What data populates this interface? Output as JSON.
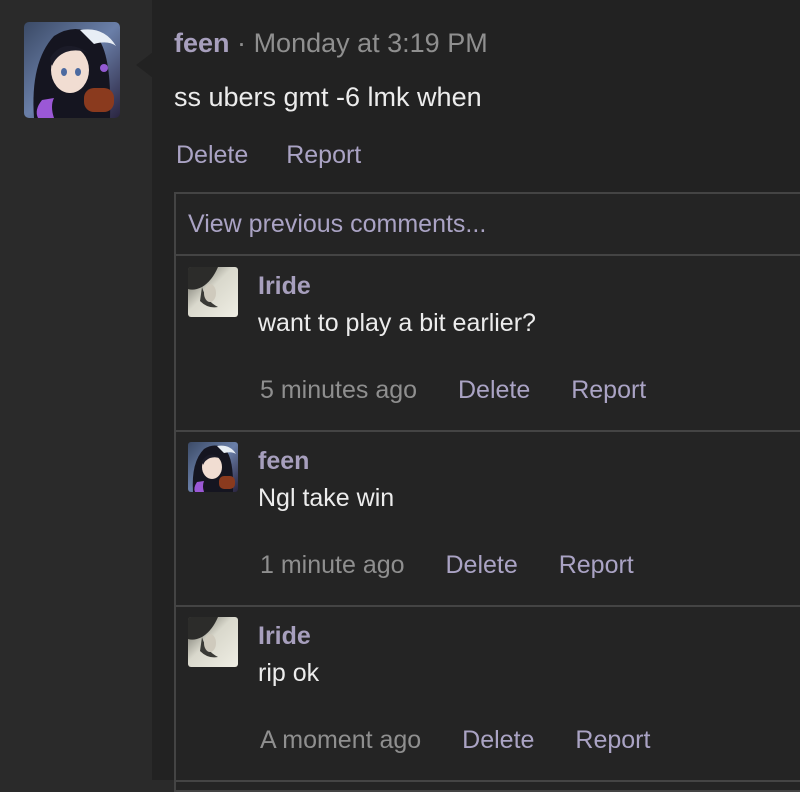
{
  "post": {
    "author": "feen",
    "separator": "·",
    "timestamp": "Monday at 3:19 PM",
    "text": "ss ubers gmt -6 lmk when",
    "actions": {
      "delete": "Delete",
      "report": "Report"
    }
  },
  "comments": {
    "view_previous": "View previous comments...",
    "items": [
      {
        "author": "Iride",
        "text": "want to play a bit earlier?",
        "time": "5 minutes ago",
        "delete": "Delete",
        "report": "Report"
      },
      {
        "author": "feen",
        "text": "Ngl take win",
        "time": "1 minute ago",
        "delete": "Delete",
        "report": "Report"
      },
      {
        "author": "Iride",
        "text": "rip ok",
        "time": "A moment ago",
        "delete": "Delete",
        "report": "Report"
      }
    ]
  },
  "colors": {
    "background": "#222222",
    "gutter": "#2a2a2a",
    "username": "#a79fbd",
    "link": "#aaa3c4",
    "text": "#ececec",
    "muted": "#8f8f8f",
    "border": "#444444"
  }
}
